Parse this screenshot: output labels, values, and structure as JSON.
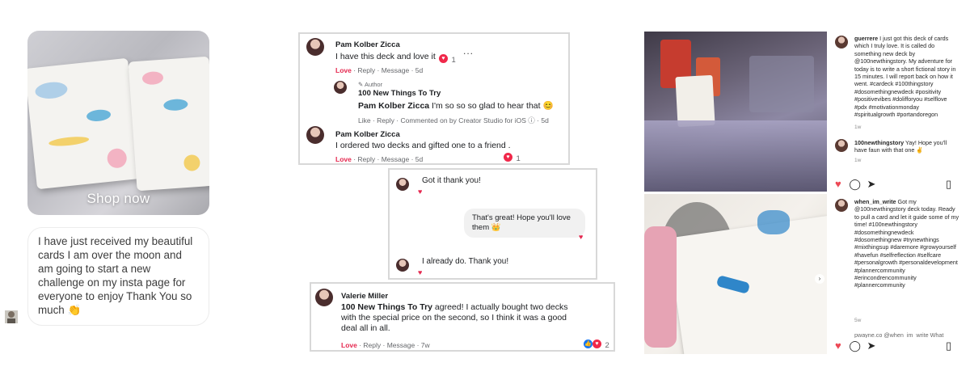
{
  "story": {
    "shop_label": "Shop now",
    "reply_text": "I have just received my beautiful cards I am over the moon and am going to start a new challenge on my insta page for everyone to enjoy Thank You so much 👏"
  },
  "fb_comment_1": {
    "name": "Pam Kolber Zicca",
    "text": "I have this deck and love it",
    "reaction_count": "1",
    "more": "...",
    "actions": {
      "love": "Love",
      "reply": "Reply",
      "message": "Message",
      "time": "5d"
    }
  },
  "fb_reply_1": {
    "badge": "Author",
    "name": "100 New Things To Try",
    "tag": "Pam Kolber Zicca",
    "text": "I'm so so so glad to hear that 😊",
    "actions": {
      "like": "Like",
      "reply": "Reply",
      "via": "Commented on by Creator Studio for iOS",
      "time": "5d"
    }
  },
  "fb_comment_2": {
    "name": "Pam Kolber Zicca",
    "text": "I ordered two decks and gifted one to a friend .",
    "reaction_count": "1",
    "actions": {
      "love": "Love",
      "reply": "Reply",
      "message": "Message",
      "time": "5d"
    }
  },
  "chat": {
    "msg1": "Got it thank you!",
    "msg2": "That's great! Hope you'll love them 👑",
    "msg3": "I already do. Thank you!"
  },
  "fb_comment_3": {
    "name": "Valerie Miller",
    "tag": "100 New Things To Try",
    "text": "agreed! I actually bought two decks with the special price on the second, so I think it was a good deal all in all.",
    "reaction_count": "2",
    "actions": {
      "love": "Love",
      "reply": "Reply",
      "message": "Message",
      "time": "7w"
    }
  },
  "ig_post_1": {
    "user": "guerrere",
    "caption": "I just got this deck of cards which I truly love. It is called do something new deck by @100newthingstory. My adventure for today is to write a short fictional story in 15 minutes. I will report back on how it went. #cardeck #100thingstory #dosomethingnewdeck #positivity #positivevibes #dolifforyou #selflove #pdx #motivationmonday #spiritualgrowth #portandoregon",
    "time": "1w",
    "reply_user": "100newthingstory",
    "reply_text": "Yay! Hope you'll have faun with that one ✌",
    "reply_time": "1w"
  },
  "ig_post_2": {
    "user": "when_im_write",
    "caption": "Got my @100newthingstory deck today. Ready to pull a card and let it guide some of my time! #100newthingstory #dosomethingnewdeck #dosomethingnew #trynewthings #mixthingsup #daremore #growyourself #havefun #selfreflection #selfcare #personalgrowth #personaldevelopment #plannercommunity #erincondrencommunity #plannercommunity",
    "time": "5w",
    "cut_line": "pwayne.co @when_im_write What"
  },
  "colors": {
    "love_red": "#e5284f",
    "fb_blue": "#1877f2",
    "ig_red": "#ed4956"
  }
}
